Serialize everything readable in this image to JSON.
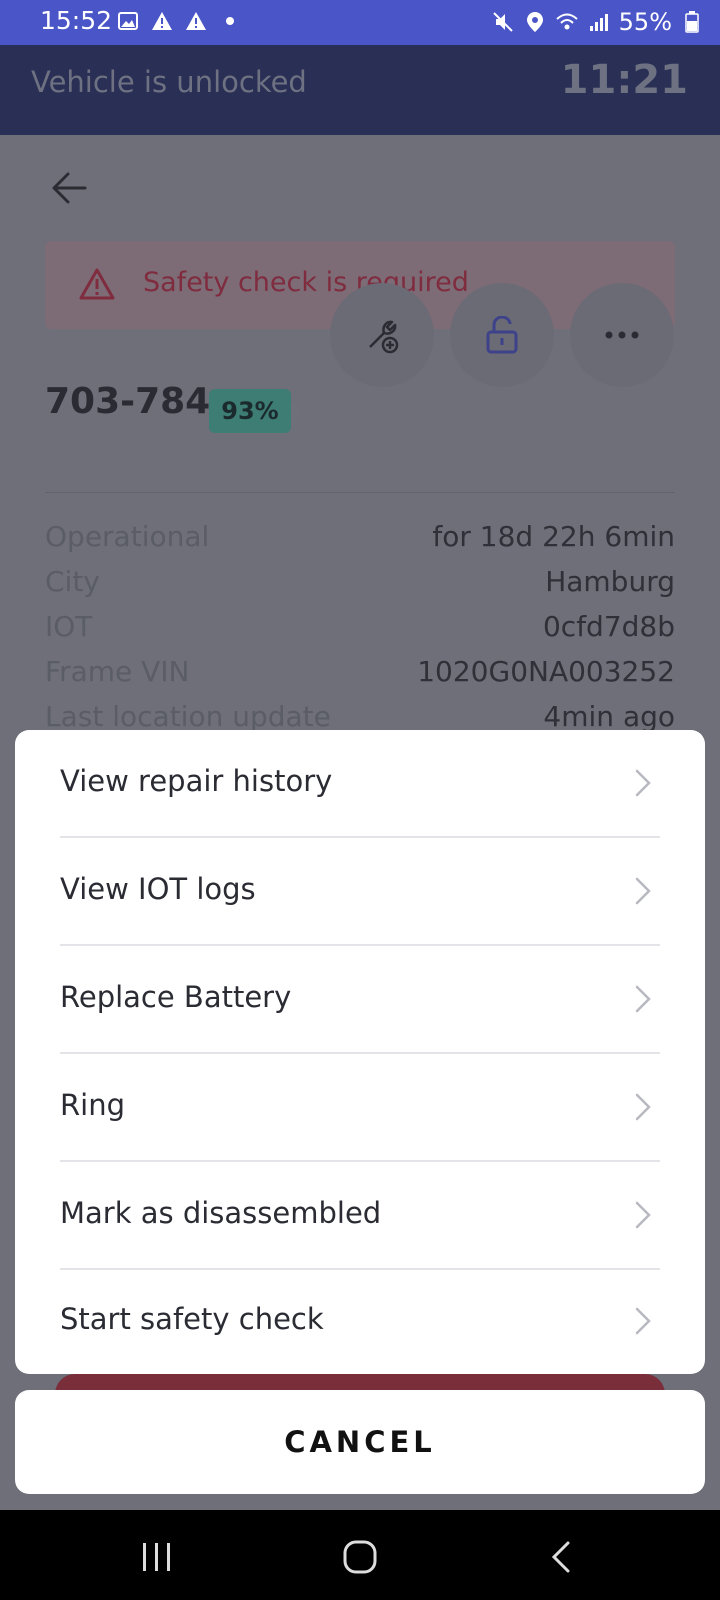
{
  "status_bar": {
    "time": "15:52",
    "battery_text": "55%"
  },
  "header": {
    "message": "Vehicle is unlocked",
    "clock": "11:21"
  },
  "alert": {
    "text": "Safety check is required"
  },
  "vehicle": {
    "id": "703-784",
    "battery": "93%"
  },
  "details": [
    {
      "label": "Operational",
      "value": "for 18d 22h 6min"
    },
    {
      "label": "City",
      "value": "Hamburg"
    },
    {
      "label": "IOT",
      "value": "0cfd7d8b"
    },
    {
      "label": "Frame VIN",
      "value": "1020G0NA003252"
    },
    {
      "label": "Last location update",
      "value": "4min ago"
    }
  ],
  "action_sheet": {
    "items": [
      {
        "label": "View repair history"
      },
      {
        "label": "View IOT logs"
      },
      {
        "label": "Replace Battery"
      },
      {
        "label": "Ring"
      },
      {
        "label": "Mark as disassembled"
      },
      {
        "label": "Start safety check"
      }
    ],
    "cancel_label": "CANCEL"
  },
  "colors": {
    "status_bar": "#4a56c8",
    "header_bg": "#2a2f55",
    "battery_badge": "#3d7d74",
    "alert_text": "#7f2c3f"
  }
}
